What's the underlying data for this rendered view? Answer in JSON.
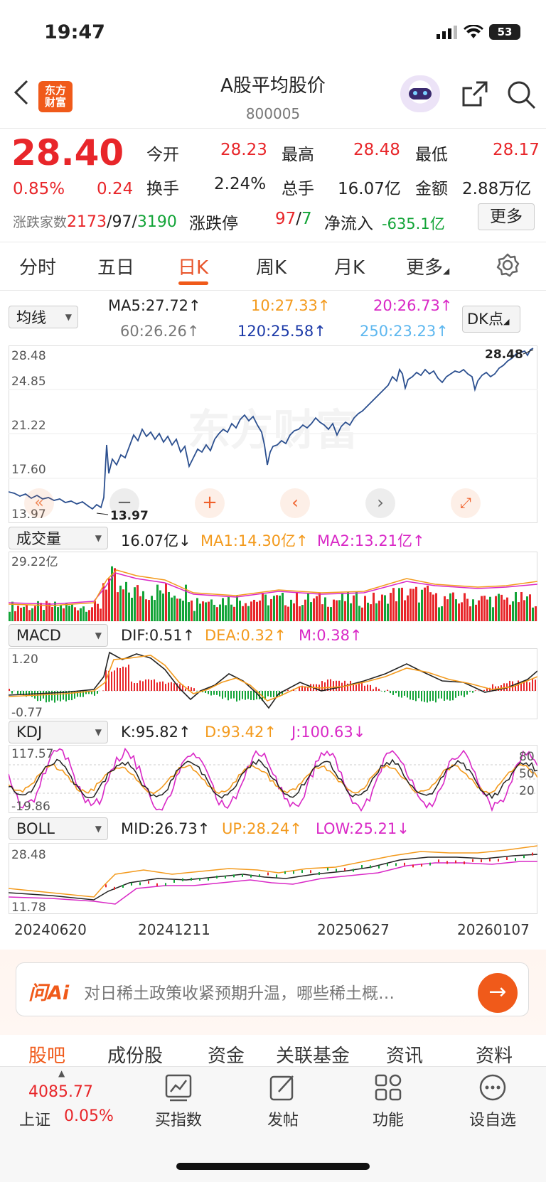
{
  "status": {
    "time": "19:47",
    "battery": "53"
  },
  "header": {
    "logo_text": "东方\n财富",
    "title": "A股平均股价",
    "code": "800005"
  },
  "quote": {
    "price": "28.40",
    "change_pct": "0.85%",
    "change": "0.24",
    "open_label": "今开",
    "open": "28.23",
    "high_label": "最高",
    "high": "28.48",
    "low_label": "最低",
    "low": "28.17",
    "turnover_label": "换手",
    "turnover": "2.24%",
    "volume_label": "总手",
    "volume": "16.07亿",
    "amount_label": "金额",
    "amount": "2.88万亿",
    "breadth_label": "涨跌家数",
    "up_count": "2173",
    "flat_count": "97",
    "down_count": "3190",
    "limit_label": "涨跌停",
    "limit_up": "97",
    "limit_down": "7",
    "inflow_label": "净流入",
    "inflow": "-635.1亿",
    "more_button": "更多",
    "sep": "/"
  },
  "tabs": [
    "分时",
    "五日",
    "日K",
    "周K",
    "月K",
    "更多"
  ],
  "ma": {
    "selector": "均线",
    "ma5": "MA5:27.72",
    "ma10": "10:27.33",
    "ma20": "20:26.73",
    "ma60": "60:26.26",
    "ma120": "120:25.58",
    "ma250": "250:23.23",
    "dk_button": "DK点"
  },
  "price_chart": {
    "y_labels": [
      "28.48",
      "24.85",
      "21.22",
      "17.60",
      "13.97"
    ],
    "max_label": "28.48",
    "min_label": "13.97",
    "watermark": "东方财富"
  },
  "volume": {
    "selector": "成交量",
    "value": "16.07亿",
    "ma1": "MA1:14.30亿",
    "ma2": "MA2:13.21亿",
    "top_label": "29.22亿"
  },
  "macd": {
    "selector": "MACD",
    "dif": "DIF:0.51",
    "dea": "DEA:0.32",
    "m": "M:0.38",
    "top_label": "1.20",
    "bottom_label": "-0.77"
  },
  "kdj": {
    "selector": "KDJ",
    "k": "K:95.82",
    "d": "D:93.42",
    "j": "J:100.63",
    "top_label": "117.57",
    "bottom_label": "-19.86",
    "ref_80": "80",
    "ref_50": "50",
    "ref_20": "20"
  },
  "boll": {
    "selector": "BOLL",
    "mid": "MID:26.73",
    "up": "UP:28.24",
    "low": "LOW:25.21",
    "top_label": "28.48",
    "bottom_label": "11.78"
  },
  "x_dates": [
    "20240620",
    "20241211",
    "20250627",
    "20260107"
  ],
  "ai": {
    "logo": "问Ai",
    "prompt": "对日稀土政策收紧预期升温，哪些稀土概…"
  },
  "subtabs": [
    "股吧",
    "成份股",
    "资金",
    "关联基金",
    "资讯",
    "资料"
  ],
  "bottom_nav": {
    "index_value": "4085.77",
    "index_name": "上证",
    "index_change": "0.05%",
    "items": [
      "买指数",
      "发帖",
      "功能",
      "设自选"
    ]
  }
}
